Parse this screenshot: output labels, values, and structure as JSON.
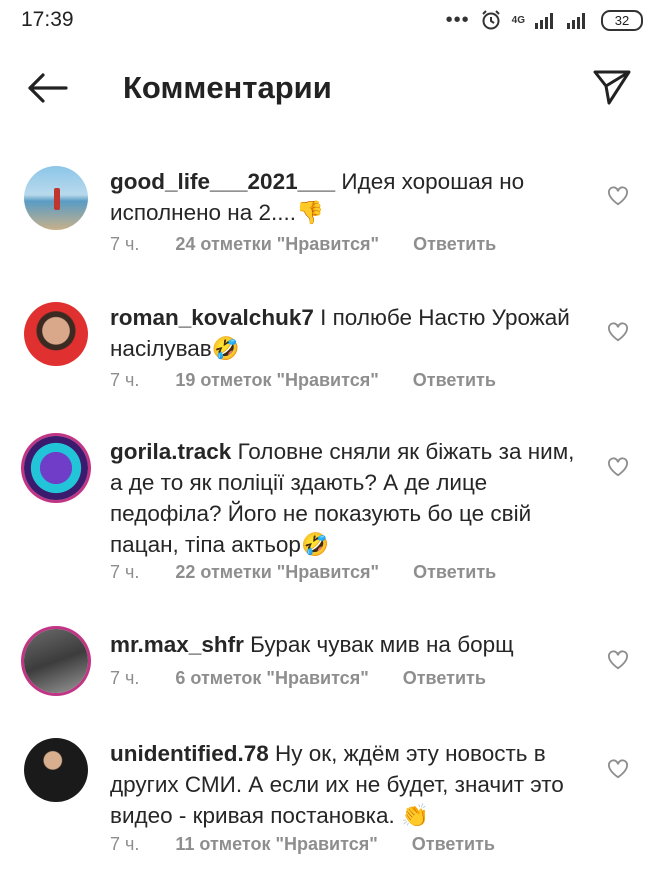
{
  "status": {
    "time": "17:39",
    "network": "4G",
    "battery": "32"
  },
  "header": {
    "title": "Комментарии"
  },
  "comments": [
    {
      "user": "good_life___2021___",
      "text": "Идея хорошая но исполнено на 2....👎",
      "time": "7 ч.",
      "likes": "24 отметки \"Нравится\"",
      "reply": "Ответить"
    },
    {
      "user": "roman_kovalchuk7",
      "text": "І полюбе Настю Урожай насілував🤣",
      "time": "7 ч.",
      "likes": "19 отметок \"Нравится\"",
      "reply": "Ответить"
    },
    {
      "user": "gorila.track",
      "text": "Головне сняли як біжать за ним, а де то як поліції здають? А де лице педофіла? Його не показують бо це свій пацан, тіпа актьор🤣",
      "time": "7 ч.",
      "likes": "22 отметки \"Нравится\"",
      "reply": "Ответить"
    },
    {
      "user": "mr.max_shfr",
      "text": "Бурак чувак мив на борщ",
      "time": "7 ч.",
      "likes": "6 отметок \"Нравится\"",
      "reply": "Ответить"
    },
    {
      "user": "unidentified.78",
      "text": "Ну ок, ждём эту новость в других СМИ. А если их не будет, значит это видео - кривая постановка. 👏",
      "time": "7 ч.",
      "likes": "11 отметок \"Нравится\"",
      "reply": "Ответить"
    }
  ]
}
